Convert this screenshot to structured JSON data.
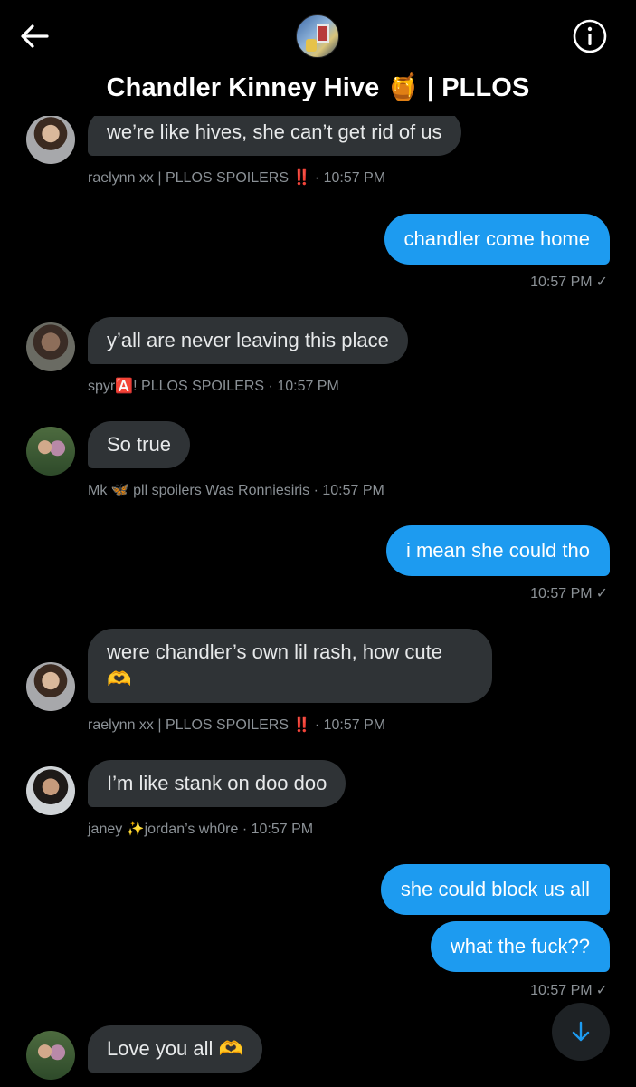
{
  "header": {
    "title": "Chandler Kinney Hive 🍯 | PLLOS",
    "back_icon": "arrow-left-icon",
    "info_icon": "info-circle-icon"
  },
  "colors": {
    "background": "#000000",
    "incoming_bubble": "#2f3336",
    "outgoing_bubble": "#1d9bf0",
    "meta_text": "#8b9196"
  },
  "messages": [
    {
      "text": "we’re like hives, she can’t get rid of us",
      "meta": "raelynn xx | PLLOS SPOILERS ‼️  · 10:57 PM"
    },
    {
      "text": "chandler come home",
      "time": "10:57 PM"
    },
    {
      "text": "y’all are never leaving this place",
      "meta": "spyr🅰️! PLLOS SPOILERS · 10:57 PM"
    },
    {
      "text": "So true",
      "meta": "Mk 🦋 pll spoilers Was Ronniesiris · 10:57 PM"
    },
    {
      "text": "i mean she could tho",
      "time": "10:57 PM"
    },
    {
      "text_line1": "were chandler’s own lil rash, how cute",
      "text_line2": "🫶",
      "meta": "raelynn xx | PLLOS SPOILERS ‼️  · 10:57 PM"
    },
    {
      "text": "I’m like stank on doo doo",
      "meta": "janey ✨jordan’s wh0re · 10:57 PM"
    },
    {
      "text": "she could block us all"
    },
    {
      "text": "what the fuck??",
      "time": "10:57 PM"
    },
    {
      "text": "Love you all 🫶"
    }
  ],
  "scroll_button_icon": "arrow-down-icon"
}
